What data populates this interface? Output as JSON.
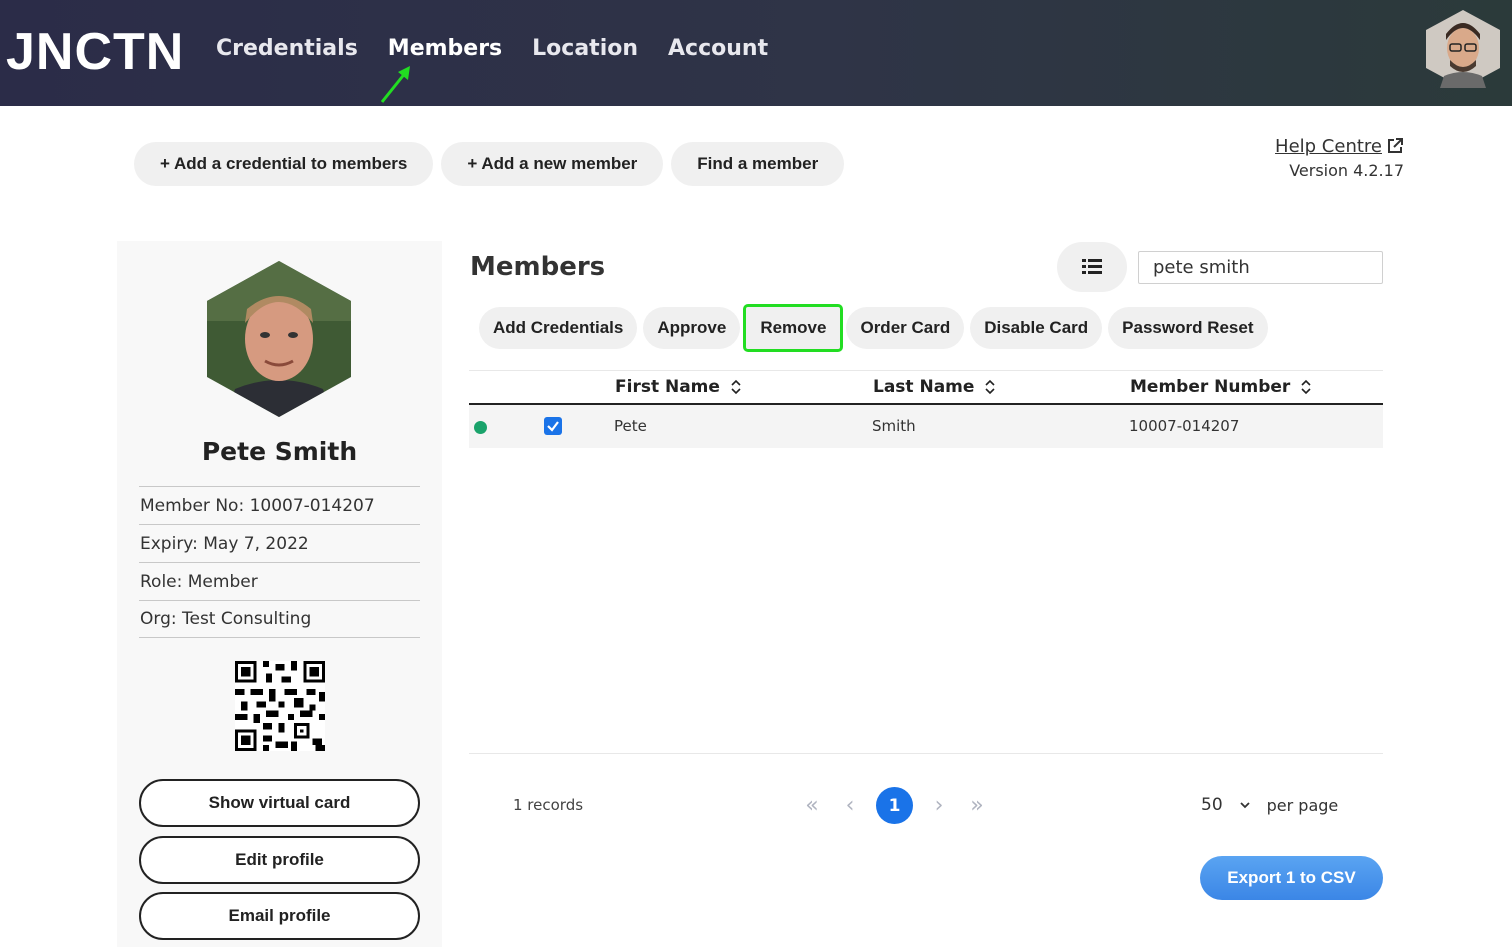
{
  "brand": {
    "logo_text": "JNCTN"
  },
  "nav": {
    "items": [
      {
        "label": "Credentials"
      },
      {
        "label": "Members"
      },
      {
        "label": "Location"
      },
      {
        "label": "Account"
      }
    ]
  },
  "quick_actions": {
    "add_credential": "+ Add a credential to members",
    "add_member": "+ Add a new member",
    "find_member": "Find a member"
  },
  "help": {
    "link": "Help Centre",
    "version": "Version 4.2.17"
  },
  "profile": {
    "name": "Pete Smith",
    "member_no": "Member No: 10007-014207",
    "expiry": "Expiry: May 7, 2022",
    "role": "Role: Member",
    "org": "Org: Test Consulting",
    "show_card": "Show virtual card",
    "edit": "Edit profile",
    "email": "Email profile"
  },
  "members": {
    "title": "Members",
    "search_value": "pete smith",
    "actions": {
      "add_credentials": "Add Credentials",
      "approve": "Approve",
      "remove": "Remove",
      "order_card": "Order Card",
      "disable_card": "Disable Card",
      "password_reset": "Password Reset"
    },
    "columns": {
      "first": "First Name",
      "last": "Last Name",
      "number": "Member Number"
    },
    "rows": [
      {
        "first": "Pete",
        "last": "Smith",
        "number": "10007-014207"
      }
    ],
    "records": "1 records",
    "page": "1",
    "per_page_value": "50",
    "per_page_label": "per page",
    "export": "Export 1 to CSV"
  },
  "colors": {
    "accent": "#1a73e8",
    "status_active": "#1aa36b",
    "highlight": "#22dd22"
  }
}
